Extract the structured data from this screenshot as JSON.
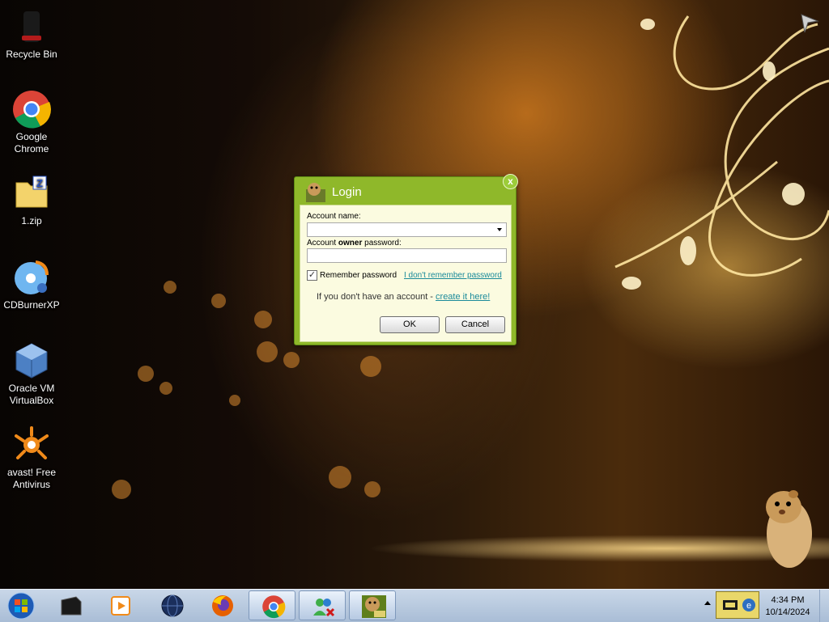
{
  "desktop": {
    "icons": [
      {
        "label": "Recycle Bin",
        "icon": "recycle-bin-icon"
      },
      {
        "label": "Google Chrome",
        "icon": "chrome-icon"
      },
      {
        "label": "1.zip",
        "icon": "zip-file-icon"
      },
      {
        "label": "CDBurnerXP",
        "icon": "cdburnerxp-icon"
      },
      {
        "label": "Oracle VM VirtualBox",
        "icon": "virtualbox-icon"
      },
      {
        "label": "avast! Free Antivirus",
        "icon": "avast-icon"
      }
    ]
  },
  "dialog": {
    "title": "Login",
    "account_name_label": "Account name:",
    "account_name_value": "",
    "password_label_pre": "Account ",
    "password_label_bold": "owner",
    "password_label_post": " password:",
    "password_value": "",
    "remember_label": "Remember password",
    "remember_checked": true,
    "forgot_link": "I don't remember password",
    "no_account_text": "If you don't have an account - ",
    "create_link": "create it here!",
    "ok_label": "OK",
    "cancel_label": "Cancel",
    "close_glyph": "x"
  },
  "taskbar": {
    "items": [
      "terminal-icon",
      "media-player-icon",
      "network-globe-icon",
      "firefox-icon",
      "chrome-icon",
      "messenger-icon",
      "sandbox-app-icon"
    ],
    "active_index": 4,
    "clock_time": "4:34 PM",
    "clock_date": "10/14/2024"
  }
}
